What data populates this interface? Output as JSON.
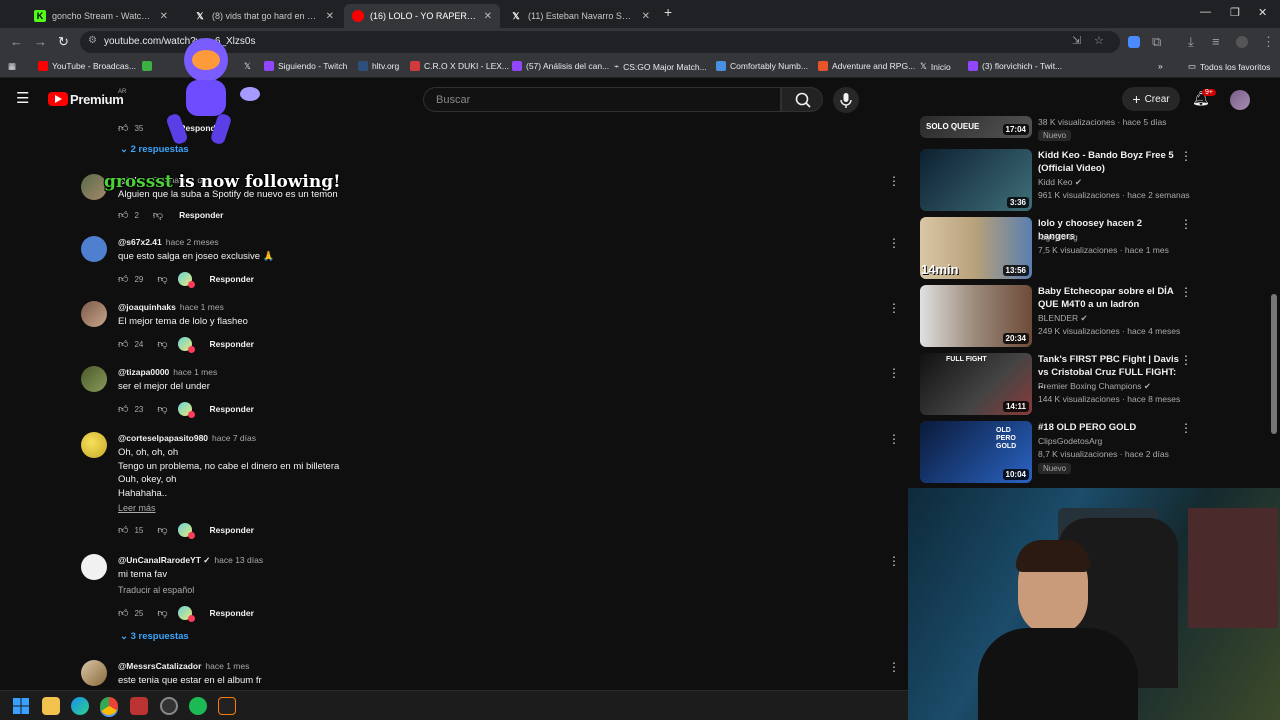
{
  "browser": {
    "tabs": [
      {
        "label": "goncho Stream - Watch Live on",
        "icon": "kick-icon",
        "active": false
      },
      {
        "label": "(8) vids that go hard en X: \"Wh",
        "icon": "x-icon",
        "active": false
      },
      {
        "label": "(16) LOLO - YO RAPERO, ELLA",
        "icon": "youtube-icon",
        "active": true
      },
      {
        "label": "(11) Esteban Navarro Soriano e",
        "icon": "x-icon",
        "active": false
      }
    ],
    "url": "youtube.com/watch?v=...6_Xlzs0s",
    "bookmarks": [
      "YouTube - Broadcas...",
      "",
      "Siguiendo - Twitch",
      "hltv.org",
      "C.R.O X DUKI - LEX...",
      "(57) Análisis del can...",
      "CS:GO Major Match...",
      "Comfortably Numb...",
      "Adventure and RPG...",
      "Inicio",
      "(3) florvichich - Twit..."
    ],
    "bookmarks_folder": "Todos los favoritos"
  },
  "yt": {
    "logo": "Premium",
    "country": "AR",
    "search_placeholder": "Buscar",
    "create_label": "Crear",
    "notif_count": "9+"
  },
  "comments": [
    {
      "handle": "@Pilo_1574",
      "time": "hace 1 día",
      "text": [
        "Alguien que la suba a Spotify de nuevo es un temon"
      ],
      "likes": "2",
      "heart": false
    },
    {
      "handle": "@s67x2.41",
      "time": "hace 2 meses",
      "text": [
        "que esto salga en joseo exclusive 🙏"
      ],
      "likes": "29",
      "heart": true
    },
    {
      "handle": "@joaquinhaks",
      "time": "hace 1 mes",
      "text": [
        "El mejor tema de lolo y flasheo"
      ],
      "likes": "24",
      "heart": true
    },
    {
      "handle": "@tizapa0000",
      "time": "hace 1 mes",
      "text": [
        "ser el mejor del under"
      ],
      "likes": "23",
      "heart": true
    },
    {
      "handle": "@corteselpapasito980",
      "time": "hace 7 días",
      "text": [
        "Oh, oh, oh, oh",
        "Tengo un problema, no cabe el dinero en mi billetera",
        "Ouh, okey, oh",
        "Hahahaha.."
      ],
      "likes": "15",
      "heart": true,
      "readmore": "Leer más"
    },
    {
      "handle": "@UnCanalRarodeYT ✓",
      "time": "hace 13 días",
      "text": [
        "mi tema fav"
      ],
      "likes": "25",
      "heart": true,
      "translate": "Traducir al español"
    },
    {
      "handle": "@MessrsCatalizador",
      "time": "hace 1 mes",
      "text": [
        "este tenia que estar en el album fr"
      ],
      "likes": "",
      "heart": false
    }
  ],
  "top_partial_comment": {
    "likes": "35",
    "reply": "Responder"
  },
  "reply_label": "Responder",
  "replies": [
    "2 respuestas",
    "3 respuestas"
  ],
  "sidebar": [
    {
      "title": "",
      "thumb_text": "SOLO QUEUE",
      "channel": "",
      "meta": "38 K visualizaciones · hace 5 días",
      "duration": "17:04",
      "badge": "Nuevo",
      "colors": [
        "#2a2a2a",
        "#555"
      ]
    },
    {
      "title": "Kidd Keo - Bando Boyz Free 5 (Official Video)",
      "channel": "Kidd Keo",
      "verified": true,
      "meta": "961 K visualizaciones · hace 2 semanas",
      "duration": "3:36",
      "colors": [
        "#0d2030",
        "#3f6f7a"
      ]
    },
    {
      "title": "lolo y choosey hacen 2 bangers",
      "channel": "rageylo og",
      "verified": false,
      "meta": "7,5 K visualizaciones · hace 1 mes",
      "duration": "13:56",
      "colors": [
        "#d9c7a5",
        "#5a7fb0"
      ]
    },
    {
      "title": "Baby Etchecopar sobre el DÍA QUE M4T0 a un ladrón",
      "channel": "BLENDER",
      "verified": true,
      "meta": "249 K visualizaciones · hace 4 meses",
      "duration": "20:34",
      "colors": [
        "#e0e0e0",
        "#6e4b3a"
      ]
    },
    {
      "title": "Tank's FIRST PBC Fight | Davis vs Cristobal Cruz FULL FIGHT: ...",
      "thumb_text": "FULL FIGHT",
      "channel": "Premier Boxing Champions",
      "verified": true,
      "meta": "144 K visualizaciones · hace 8 meses",
      "duration": "14:11",
      "colors": [
        "#111",
        "#8a3b3b"
      ]
    },
    {
      "title": "#18 OLD PERO GOLD",
      "thumb_text": "OLD PERO GOLD",
      "channel": "ClipsGodetosArg",
      "verified": false,
      "meta": "8,7 K visualizaciones · hace 2 días",
      "duration": "10:04",
      "badge": "Nuevo",
      "colors": [
        "#0a1a3a",
        "#2a63c2"
      ]
    }
  ],
  "overlay": {
    "follow_user": "grossst",
    "follow_text": "is now following!",
    "min_label": "14min"
  }
}
